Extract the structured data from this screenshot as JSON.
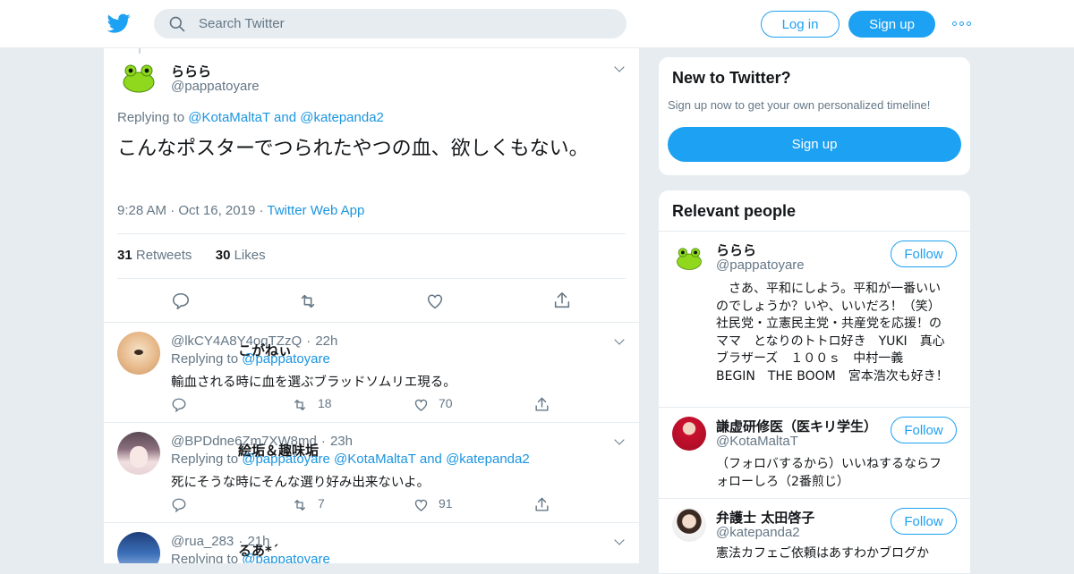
{
  "header": {
    "search_placeholder": "Search Twitter",
    "login_label": "Log in",
    "signup_label": "Sign up",
    "brand_color": "#1da1f2"
  },
  "main_tweet": {
    "name": "ららら",
    "handle": "@pappatoyare",
    "replying_prefix": "Replying to",
    "replying_to_1": "@KotaMaltaT",
    "replying_and": "and",
    "replying_to_2": "@katepanda2",
    "text": "こんなポスターでつられたやつの血、欲しくもない。",
    "time": "9:28 AM",
    "date": "Oct 16, 2019",
    "source": "Twitter Web App",
    "retweets_count": "31",
    "retweets_label": "Retweets",
    "likes_count": "30",
    "likes_label": "Likes"
  },
  "replies": [
    {
      "name": "こがねぃ",
      "handle": "@lkCY4A8Y4oqTZzQ",
      "time": "22h",
      "replying_prefix": "Replying to",
      "replying_to": "@pappatoyare",
      "text": "輸血される時に血を選ぶブラッドソムリエ現る。",
      "retweets": "18",
      "likes": "70"
    },
    {
      "name": "絵垢＆趣味垢",
      "handle": "@BPDdne6Zm7XW8md",
      "time": "23h",
      "replying_prefix": "Replying to",
      "replying_to_1": "@pappatoyare",
      "replying_to_2": "@KotaMaltaT",
      "replying_and": "and",
      "replying_to_3": "@katepanda2",
      "text": "死にそうな時にそんな選り好み出来ないよ。",
      "retweets": "7",
      "likes": "91"
    },
    {
      "name": "るあ*´",
      "handle": "@rua_283",
      "time": "21h",
      "replying_prefix": "Replying to",
      "replying_to": "@pappatoyare"
    }
  ],
  "new_to_twitter": {
    "title": "New to Twitter?",
    "subtitle": "Sign up now to get your own personalized timeline!",
    "signup_label": "Sign up"
  },
  "relevant": {
    "title": "Relevant people",
    "follow_label": "Follow",
    "people": [
      {
        "name": "ららら",
        "handle": "@pappatoyare",
        "bio": "　さあ、平和にしよう。平和が一番いいのでしょうか？いや、いいだろ！（笑）　社民党・立憲民主党・共産党を応援！のママ　となりのトトロ好き　YUKI　真心ブラザーズ　１００ｓ　中村一義　BEGIN　THE BOOM　宮本浩次も好き！"
      },
      {
        "name": "謙虚研修医（医キリ学生）",
        "handle": "@KotaMaltaT",
        "bio": "（フォロバするから）いいねするならフォローしろ（2番煎じ）"
      },
      {
        "name": "弁護士 太田啓子",
        "handle": "@katepanda2",
        "bio": "憲法カフェご依頼はあすわかブログか"
      }
    ]
  }
}
